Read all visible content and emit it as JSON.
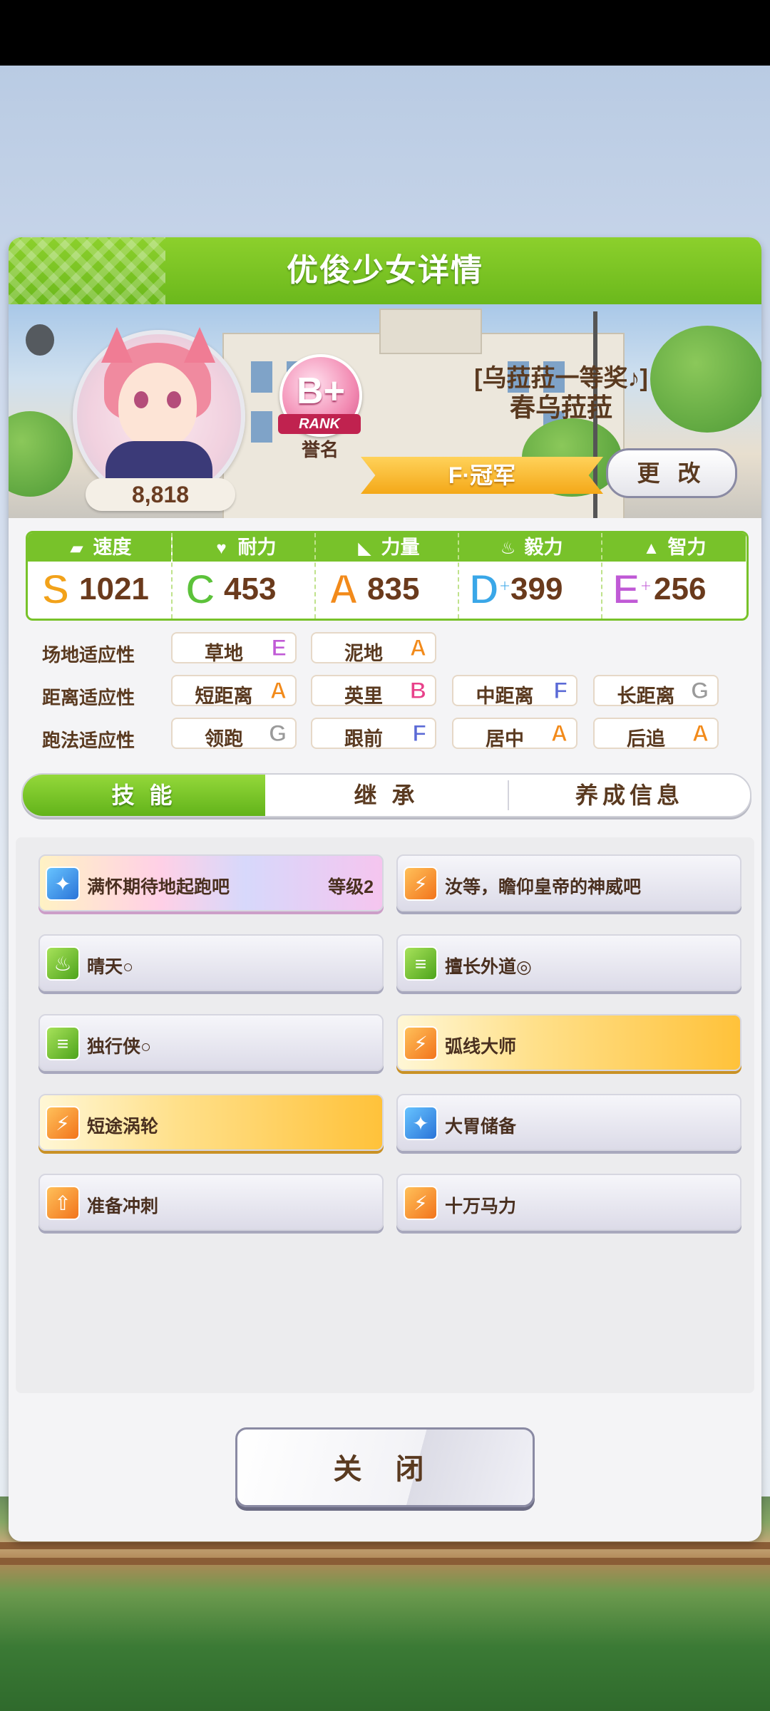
{
  "dialog": {
    "title": "优俊少女详情"
  },
  "profile": {
    "fans": "8,818",
    "rank_letter": "B+",
    "rank_ribbon": "RANK",
    "rank_label": "誉名",
    "title": "[乌菈菈一等奖♪]",
    "name": "春乌菈菈",
    "class": "F·冠军",
    "change_label": "更 改"
  },
  "stats": [
    {
      "label": "速度",
      "icon": "shoe-icon",
      "grade": "S",
      "plus": "",
      "value": "1021",
      "color": "#f2a21a"
    },
    {
      "label": "耐力",
      "icon": "heart-icon",
      "grade": "C",
      "plus": "",
      "value": "453",
      "color": "#5cc23a"
    },
    {
      "label": "力量",
      "icon": "muscle-icon",
      "grade": "A",
      "plus": "",
      "value": "835",
      "color": "#f28a1a"
    },
    {
      "label": "毅力",
      "icon": "flame-icon",
      "grade": "D",
      "plus": "+",
      "value": "399",
      "color": "#3aa7e8"
    },
    {
      "label": "智力",
      "icon": "cap-icon",
      "grade": "E",
      "plus": "+",
      "value": "256",
      "color": "#c05ad6"
    }
  ],
  "aptitude": {
    "track_label": "场地适应性",
    "distance_label": "距离适应性",
    "style_label": "跑法适应性",
    "track": [
      {
        "name": "草地",
        "grade": "E"
      },
      {
        "name": "泥地",
        "grade": "A"
      }
    ],
    "distance": [
      {
        "name": "短距离",
        "grade": "A"
      },
      {
        "name": "英里",
        "grade": "B"
      },
      {
        "name": "中距离",
        "grade": "F"
      },
      {
        "name": "长距离",
        "grade": "G"
      }
    ],
    "style": [
      {
        "name": "领跑",
        "grade": "G"
      },
      {
        "name": "跟前",
        "grade": "F"
      },
      {
        "name": "居中",
        "grade": "A"
      },
      {
        "name": "后追",
        "grade": "A"
      }
    ]
  },
  "grade_colors": {
    "A": "#f28a1a",
    "B": "#e8418a",
    "E": "#c05ad6",
    "F": "#5b6ad6",
    "G": "#9a9a9a"
  },
  "tabs": [
    {
      "label": "技 能",
      "active": true
    },
    {
      "label": "继 承"
    },
    {
      "label": "养成信息"
    }
  ],
  "skills": [
    {
      "name": "满怀期待地起跑吧",
      "level": "等级2",
      "style": "rainbow",
      "icon": "sparkle-icon"
    },
    {
      "name": "汝等，瞻仰皇帝的神威吧",
      "level": "",
      "style": "normal",
      "icon": "runner-icon"
    },
    {
      "name": "晴天○",
      "level": "",
      "style": "normal",
      "icon": "flame-icon"
    },
    {
      "name": "擅长外道◎",
      "level": "",
      "style": "normal",
      "icon": "notes-icon"
    },
    {
      "name": "独行侠○",
      "level": "",
      "style": "normal",
      "icon": "notes-icon"
    },
    {
      "name": "弧线大师",
      "level": "",
      "style": "gold",
      "icon": "runner-icon"
    },
    {
      "name": "短途涡轮",
      "level": "",
      "style": "gold",
      "icon": "runner-icon"
    },
    {
      "name": "大胃储备",
      "level": "",
      "style": "normal",
      "icon": "sparkle-icon"
    },
    {
      "name": "准备冲刺",
      "level": "",
      "style": "normal",
      "icon": "gate-icon"
    },
    {
      "name": "十万马力",
      "level": "",
      "style": "normal",
      "icon": "runner-icon"
    }
  ],
  "close_label": "关 闭"
}
